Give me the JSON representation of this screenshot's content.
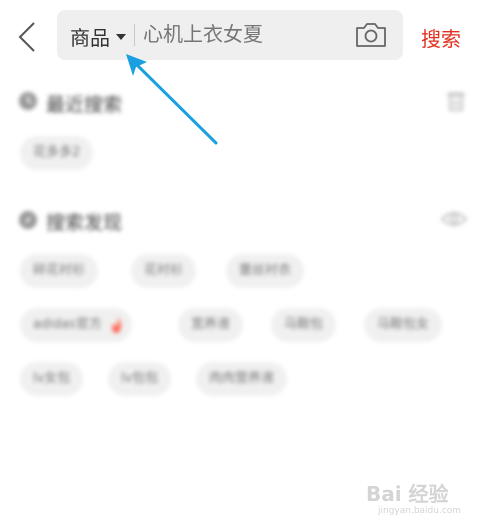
{
  "header": {
    "category_label": "商品",
    "search_placeholder": "心机上衣女夏",
    "search_button_label": "搜索"
  },
  "recent": {
    "title": "最近搜索",
    "items": [
      "花多多2"
    ]
  },
  "discover": {
    "title": "搜索发现",
    "items": [
      "碎花衬衫",
      "花衬衫",
      "蕾丝衬衣",
      "adidas官方",
      "宽养液",
      "马鞍包",
      "马鞍包女",
      "lv女包",
      "lv包包",
      "肉肉营养液"
    ]
  },
  "watermark": {
    "brand": "Bai 经验",
    "url": "jingyan.baidu.com"
  },
  "colors": {
    "accent": "#e0301e",
    "arrow": "#1aa0e0",
    "chip_bg": "#f0f0f0"
  },
  "icons": [
    "back-arrow-icon",
    "caret-down-icon",
    "camera-icon",
    "clock-icon",
    "trash-icon",
    "compass-icon",
    "eye-icon",
    "fire-icon"
  ]
}
